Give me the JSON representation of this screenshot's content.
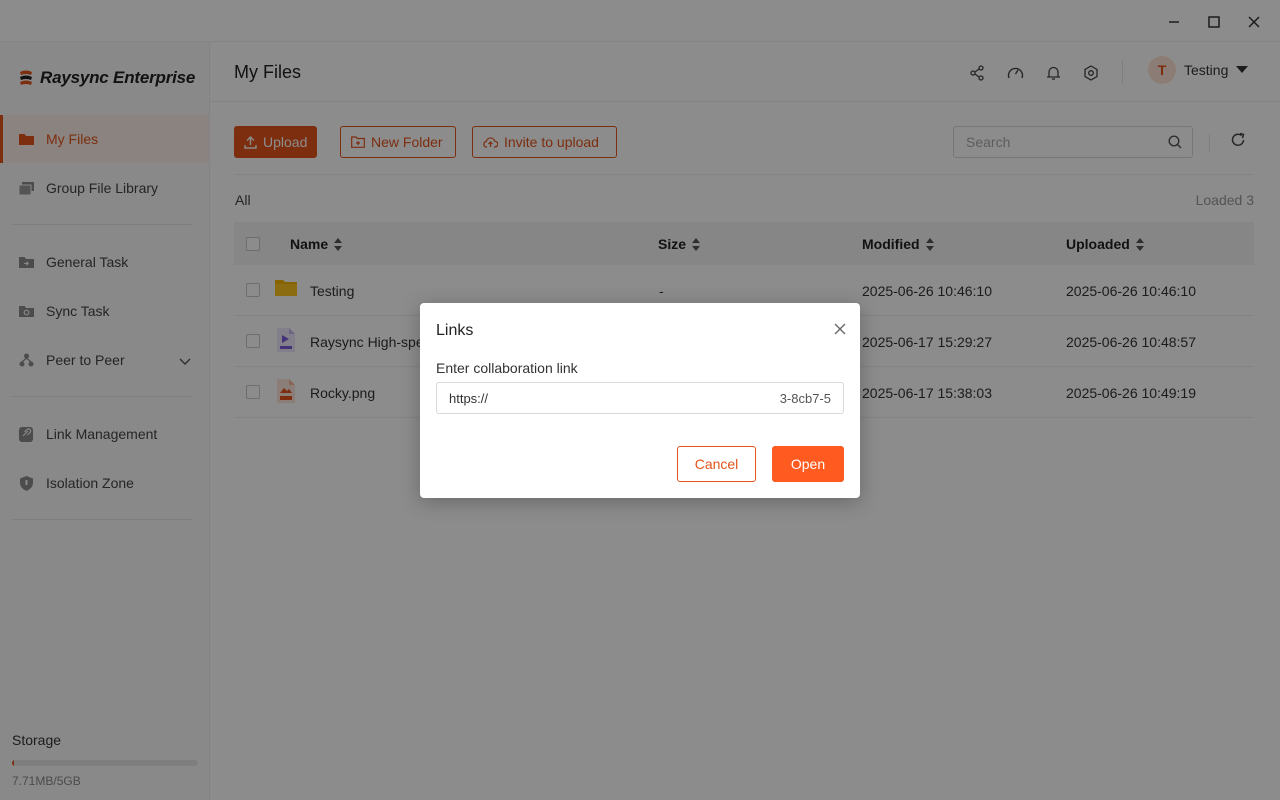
{
  "app": {
    "name": "Raysync Enterprise"
  },
  "window_controls": {
    "minimize": "minimize-icon",
    "maximize": "maximize-icon",
    "close": "close-icon"
  },
  "sidebar": {
    "items": [
      {
        "label": "My Files",
        "icon": "folder-icon",
        "active": true
      },
      {
        "label": "Group File Library",
        "icon": "library-icon"
      },
      {
        "label": "General Task",
        "icon": "task-icon"
      },
      {
        "label": "Sync Task",
        "icon": "sync-icon"
      },
      {
        "label": "Peer to Peer",
        "icon": "peer-icon",
        "expandable": true
      },
      {
        "label": "Link Management",
        "icon": "link-icon"
      },
      {
        "label": "Isolation Zone",
        "icon": "shield-icon"
      }
    ],
    "storage": {
      "label": "Storage",
      "usage_text": "7.71MB/5GB",
      "used_fraction": 0.0015
    }
  },
  "header": {
    "title": "My Files",
    "icons": [
      "share-icon",
      "speed-icon",
      "bell-icon",
      "settings-icon"
    ],
    "user": {
      "initial": "T",
      "name": "Testing"
    }
  },
  "toolbar": {
    "upload_label": "Upload",
    "new_folder_label": "New Folder",
    "invite_label": "Invite to upload",
    "search_placeholder": "Search"
  },
  "list": {
    "filter_label": "All",
    "loaded_text": "Loaded 3",
    "columns": {
      "name": "Name",
      "size": "Size",
      "modified": "Modified",
      "uploaded": "Uploaded"
    },
    "rows": [
      {
        "type": "folder",
        "name": "Testing",
        "size": "-",
        "modified": "2025-06-26 10:46:10",
        "uploaded": "2025-06-26 10:46:10"
      },
      {
        "type": "mp4",
        "name": "Raysync High-spe",
        "size": "",
        "modified": "2025-06-17 15:29:27",
        "uploaded": "2025-06-26 10:48:57"
      },
      {
        "type": "png",
        "name": "Rocky.png",
        "size": "",
        "modified": "2025-06-17 15:38:03",
        "uploaded": "2025-06-26 10:49:19"
      }
    ]
  },
  "dialog": {
    "title": "Links",
    "field_label": "Enter collaboration link",
    "input_start": "https://",
    "input_end": "3-8cb7-5",
    "cancel_label": "Cancel",
    "open_label": "Open"
  },
  "colors": {
    "accent": "#e2541c",
    "open_button": "#ff5a1f"
  }
}
